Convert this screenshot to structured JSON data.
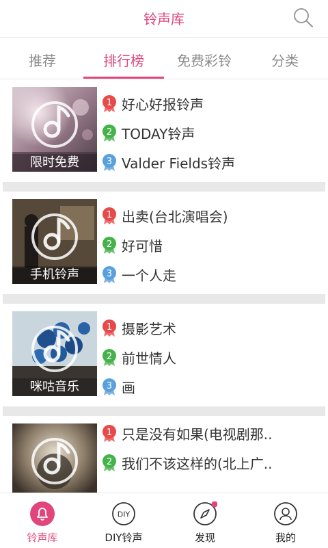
{
  "header": {
    "title": "铃声库",
    "search_icon": "search-icon"
  },
  "tabs": [
    {
      "label": "推荐"
    },
    {
      "label": "排行榜"
    },
    {
      "label": "免费彩铃"
    },
    {
      "label": "分类"
    }
  ],
  "active_tab": 1,
  "badge_colors": {
    "1": "#e84a4a",
    "2": "#46b24a",
    "3": "#5aa0dd"
  },
  "sections": [
    {
      "caption": "限时免费",
      "songs": [
        {
          "rank": "1",
          "title": "好心好报铃声"
        },
        {
          "rank": "2",
          "title": "TODAY铃声"
        },
        {
          "rank": "3",
          "title": "Valder Fields铃声"
        }
      ]
    },
    {
      "caption": "手机铃声",
      "songs": [
        {
          "rank": "1",
          "title": "出卖(台北演唱会)"
        },
        {
          "rank": "2",
          "title": "好可惜"
        },
        {
          "rank": "3",
          "title": "一个人走"
        }
      ]
    },
    {
      "caption": "咪咕音乐",
      "songs": [
        {
          "rank": "1",
          "title": "摄影艺术"
        },
        {
          "rank": "2",
          "title": "前世情人"
        },
        {
          "rank": "3",
          "title": "画"
        }
      ]
    },
    {
      "caption": "",
      "songs": [
        {
          "rank": "1",
          "title": "只是没有如果(电视剧那.."
        },
        {
          "rank": "2",
          "title": "我们不该这样的(北上广.."
        }
      ]
    }
  ],
  "bottom_nav": [
    {
      "label": "铃声库",
      "icon": "bell-icon"
    },
    {
      "label": "DIY铃声",
      "icon": "diy-icon"
    },
    {
      "label": "发现",
      "icon": "compass-icon"
    },
    {
      "label": "我的",
      "icon": "user-icon"
    }
  ],
  "accent": "#e0457b"
}
